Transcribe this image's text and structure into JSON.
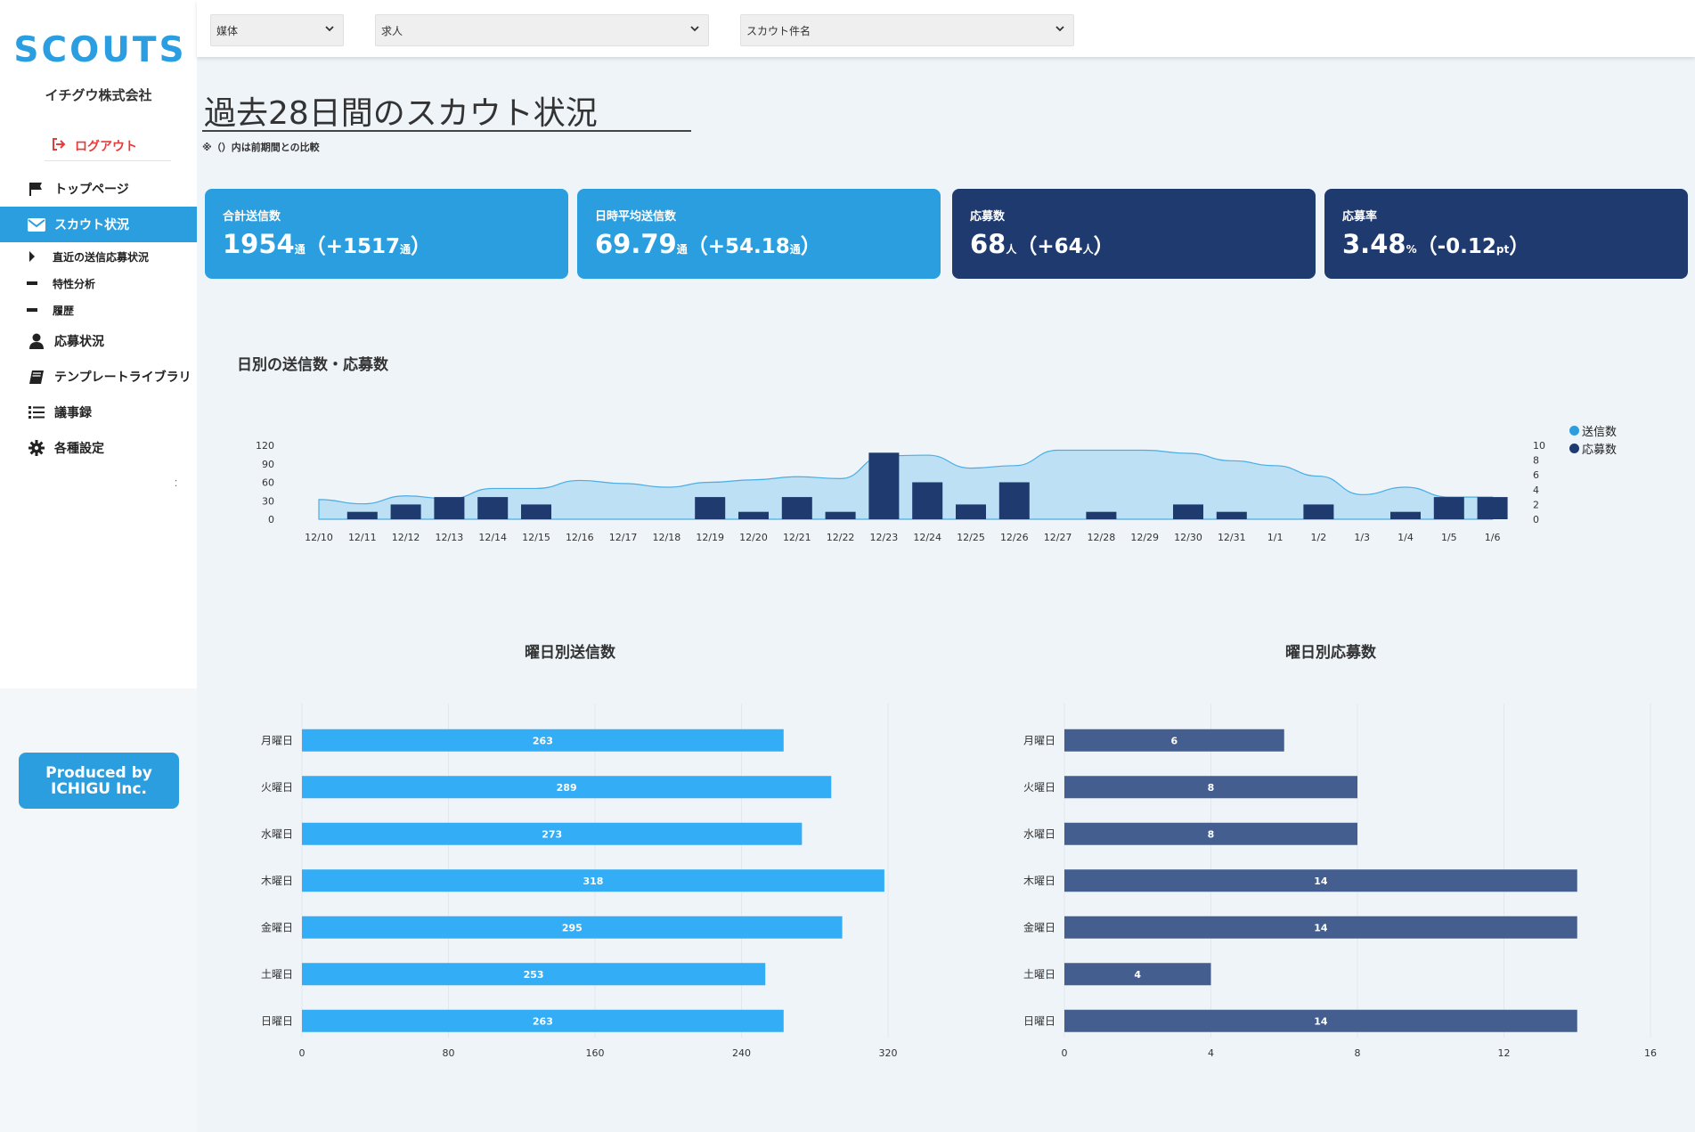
{
  "sidebar": {
    "logo": "SCOUTS",
    "company": "イチグウ株式会社",
    "logout": "ログアウト",
    "nav": [
      {
        "label": "トップページ",
        "icon": "flag-icon"
      },
      {
        "label": "スカウト状況",
        "icon": "envelope-icon",
        "active": true
      },
      {
        "label": "応募状況",
        "icon": "user-icon"
      },
      {
        "label": "テンプレートライブラリ",
        "icon": "book-icon"
      },
      {
        "label": "議事録",
        "icon": "list-icon"
      },
      {
        "label": "各種設定",
        "icon": "gear-icon"
      }
    ],
    "sub_nav": [
      {
        "label": "直近の送信応募状況",
        "icon": "caret-right-icon"
      },
      {
        "label": "特性分析",
        "icon": "dash-icon"
      },
      {
        "label": "履歴",
        "icon": "dash-icon"
      }
    ],
    "produced_line1": "Produced by",
    "produced_line2": "ICHIGU Inc."
  },
  "filters": {
    "media": "媒体",
    "job": "求人",
    "scout_name": "スカウト件名"
  },
  "header": {
    "title": "過去28日間のスカウト状況",
    "note": "※（）内は前期間との比較"
  },
  "cards": [
    {
      "label": "合計送信数",
      "value": "1954",
      "unit": "通",
      "diff_open": "（+1517",
      "diff_unit": "通",
      "diff_close": "）"
    },
    {
      "label": "日時平均送信数",
      "value": "69.79",
      "unit": "通",
      "diff_open": "（+54.18",
      "diff_unit": "通",
      "diff_close": "）"
    },
    {
      "label": "応募数",
      "value": "68",
      "unit": "人",
      "diff_open": "（+64",
      "diff_unit": "人",
      "diff_close": "）"
    },
    {
      "label": "応募率",
      "value": "3.48",
      "unit": "%",
      "diff_open": "（-0.12",
      "diff_unit": "pt",
      "diff_close": "）"
    }
  ],
  "colors": {
    "accent": "#2b9ee0",
    "dark": "#1e3a6e",
    "bar_sent": "#33adf5",
    "bar_apps": "#445e8f",
    "area": "#bde0f5",
    "area_line": "#49aee4",
    "logout": "#e53b3b"
  },
  "chart_data": [
    {
      "type": "bar+area",
      "title": "日別の送信数・応募数",
      "categories": [
        "12/10",
        "12/11",
        "12/12",
        "12/13",
        "12/14",
        "12/15",
        "12/16",
        "12/17",
        "12/18",
        "12/19",
        "12/20",
        "12/21",
        "12/22",
        "12/23",
        "12/24",
        "12/25",
        "12/26",
        "12/27",
        "12/28",
        "12/29",
        "12/30",
        "12/31",
        "1/1",
        "1/2",
        "1/3",
        "1/4",
        "1/5",
        "1/6"
      ],
      "series": [
        {
          "name": "送信数",
          "type": "area",
          "axis": "left",
          "values": [
            32,
            25,
            38,
            33,
            50,
            50,
            63,
            58,
            52,
            60,
            64,
            69,
            66,
            103,
            104,
            83,
            87,
            112,
            112,
            112,
            107,
            95,
            87,
            70,
            40,
            52,
            36,
            36
          ]
        },
        {
          "name": "応募数",
          "type": "bar",
          "axis": "right",
          "values": [
            0,
            1,
            2,
            3,
            3,
            2,
            0,
            0,
            0,
            3,
            1,
            3,
            1,
            9,
            5,
            2,
            5,
            0,
            1,
            0,
            2,
            1,
            0,
            2,
            0,
            1,
            3,
            3
          ]
        }
      ],
      "y_left": {
        "ticks": [
          0,
          30,
          60,
          90,
          120
        ],
        "max": 120
      },
      "y_right": {
        "ticks": [
          0,
          2,
          4,
          6,
          8,
          10
        ],
        "max": 10
      },
      "legend": "top-right"
    },
    {
      "type": "bar",
      "orientation": "horizontal",
      "title": "曜日別送信数",
      "categories": [
        "月曜日",
        "火曜日",
        "水曜日",
        "木曜日",
        "金曜日",
        "土曜日",
        "日曜日"
      ],
      "values": [
        263,
        289,
        273,
        318,
        295,
        253,
        263
      ],
      "xlim": [
        0,
        320
      ],
      "xticks": [
        0,
        80,
        160,
        240,
        320
      ]
    },
    {
      "type": "bar",
      "orientation": "horizontal",
      "title": "曜日別応募数",
      "categories": [
        "月曜日",
        "火曜日",
        "水曜日",
        "木曜日",
        "金曜日",
        "土曜日",
        "日曜日"
      ],
      "values": [
        6,
        8,
        8,
        14,
        14,
        4,
        14
      ],
      "xlim": [
        0,
        16
      ],
      "xticks": [
        0,
        4,
        8,
        12,
        16
      ]
    }
  ]
}
